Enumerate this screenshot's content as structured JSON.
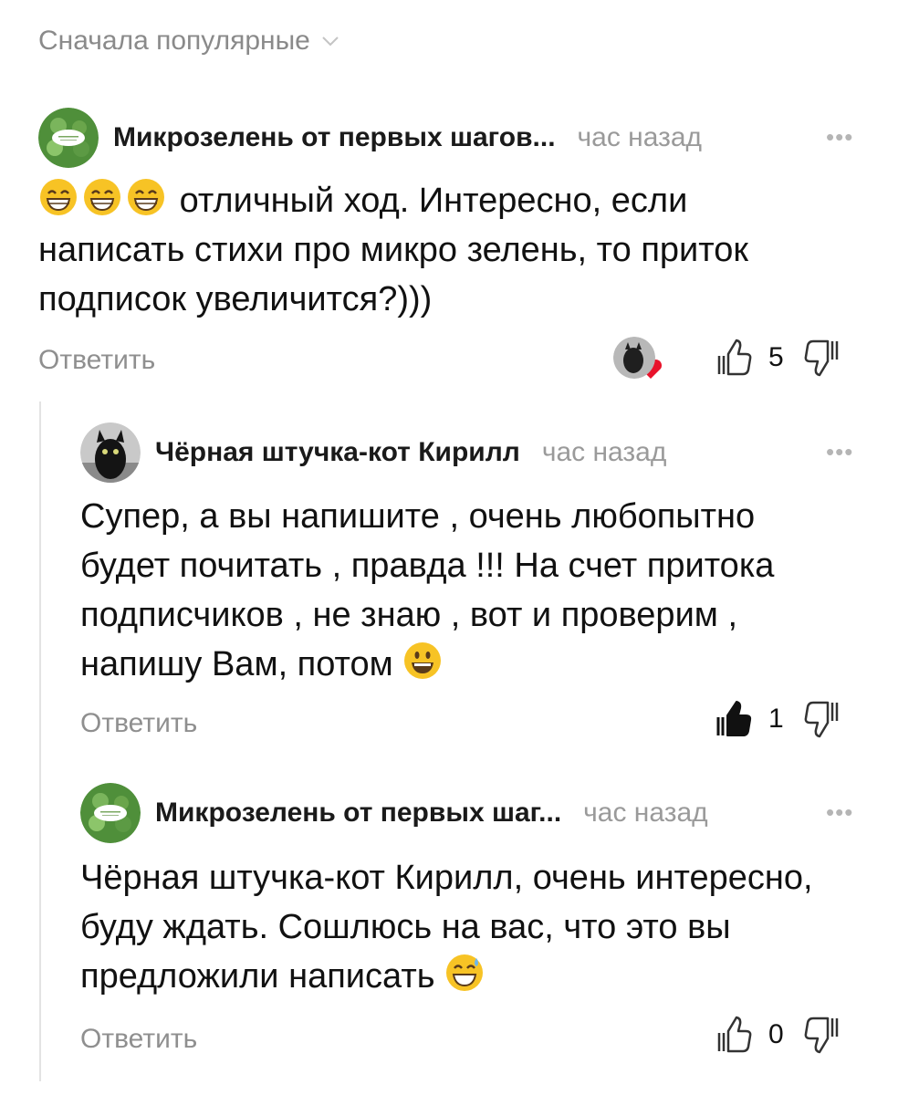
{
  "sort": {
    "label": "Сначала популярные"
  },
  "comments": [
    {
      "author": "Микрозелень от первых шагов...",
      "time": "час назад",
      "more": "•••",
      "text_lines": [
        "отличный ход. Интересно, если",
        "написать стихи про микро зелень, то приток",
        "подписок увеличится?)))"
      ],
      "reply": "Ответить",
      "likes": "5"
    },
    {
      "author": "Чёрная штучка-кот Кирилл",
      "time": "час назад",
      "more": "•••",
      "text_lines": [
        "Супер, а вы напишите , очень любопытно",
        "будет почитать , правда !!! На счет притока",
        "подписчиков , не знаю , вот и проверим ,",
        "напишу Вам, потом"
      ],
      "reply": "Ответить",
      "likes": "1"
    },
    {
      "author": "Микрозелень от первых шаг...",
      "time": "час назад",
      "more": "•••",
      "text_lines": [
        "Чёрная штучка-кот Кирилл,  очень интересно,",
        "буду ждать. Сошлюсь на вас, что это вы",
        "предложили  написать"
      ],
      "reply": "Ответить",
      "likes": "0"
    }
  ],
  "colors": {
    "accent_heart": "#e8132b",
    "muted": "#8f8f8f",
    "emoji": "#f7c325"
  }
}
